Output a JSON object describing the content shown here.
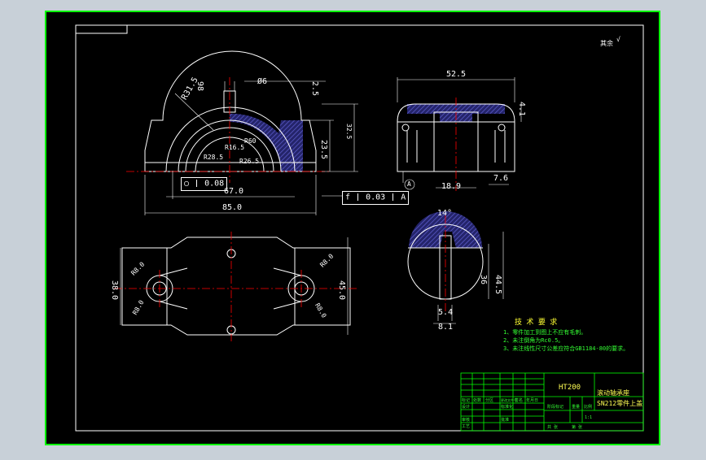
{
  "colors": {
    "background": "#c8d0d8",
    "sheet": "#000000",
    "frame": "#00ff00",
    "lines": "#ffffff",
    "centerline": "#ff0000",
    "hatch": "#3c3c9c",
    "text_green": "#33ff33",
    "text_yellow": "#ffff33"
  },
  "roughness_note": "其余",
  "top_left_view": {
    "dims": [
      "R31.5",
      "98",
      "Ø6",
      "2.5",
      "32.5",
      "23.5",
      "R28.5",
      "R26.5",
      "67.0",
      "85.0",
      "R60",
      "R16.5"
    ],
    "tolerance_1": {
      "symbol": "○",
      "value": "0.08"
    },
    "tolerance_2": {
      "symbol": "f",
      "value": "0.03",
      "datum": "A"
    }
  },
  "top_right_view": {
    "dims": [
      "52.5",
      "4.1",
      "18.9",
      "7.6"
    ],
    "datum": "A"
  },
  "bottom_left_view": {
    "dims": [
      "R8.0",
      "R8.0",
      "R8.0",
      "R8.0",
      "38.0",
      "45.0"
    ]
  },
  "bottom_right_view": {
    "dims": [
      "14°",
      "36",
      "44.5",
      "5.4",
      "8.1"
    ]
  },
  "tech_requirements": {
    "title": "技 术 要 求",
    "items": [
      "1、零件加工到图上不应有毛刺。",
      "2、未注倒角为Rc0.5。",
      "3、未注线性尺寸公差应符合GB1184-80的要求。"
    ]
  },
  "title_block": {
    "material": "HT200",
    "part_name_1": "滚动轴承座",
    "part_name_2": "SN212零件上盖",
    "labels": [
      "标记",
      "处数",
      "分区",
      "更改文件号",
      "签名",
      "年月日",
      "设计",
      "标准化",
      "阶段标记",
      "重量",
      "比例",
      "审核",
      "工艺",
      "批准",
      "共 张",
      "第 张"
    ],
    "scale": "1:1"
  }
}
